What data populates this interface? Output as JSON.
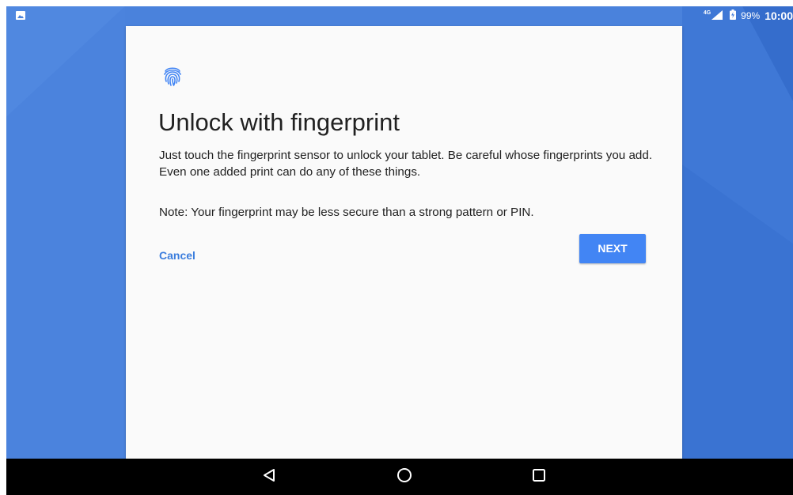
{
  "status_bar": {
    "notification_icon": "image-icon",
    "network_type": "4G",
    "signal_icon": "signal-icon",
    "battery_icon": "battery-charging-icon",
    "battery_percent": "99%",
    "time": "10:00"
  },
  "dialog": {
    "icon": "fingerprint-icon",
    "title": "Unlock with fingerprint",
    "description": "Just touch the fingerprint sensor to unlock your tablet. Be careful whose fingerprints you add. Even one added print can do any of these things.",
    "note": "Note: Your fingerprint may be less secure than a strong pattern or PIN.",
    "cancel_label": "Cancel",
    "next_label": "NEXT"
  },
  "nav_bar": {
    "back_icon": "back-icon",
    "home_icon": "home-icon",
    "recents_icon": "recents-icon"
  },
  "colors": {
    "wallpaper": "#4a82dc",
    "accent": "#4285f4",
    "link": "#3b7ddd",
    "card": "#fafafa",
    "nav_bar": "#000000"
  }
}
